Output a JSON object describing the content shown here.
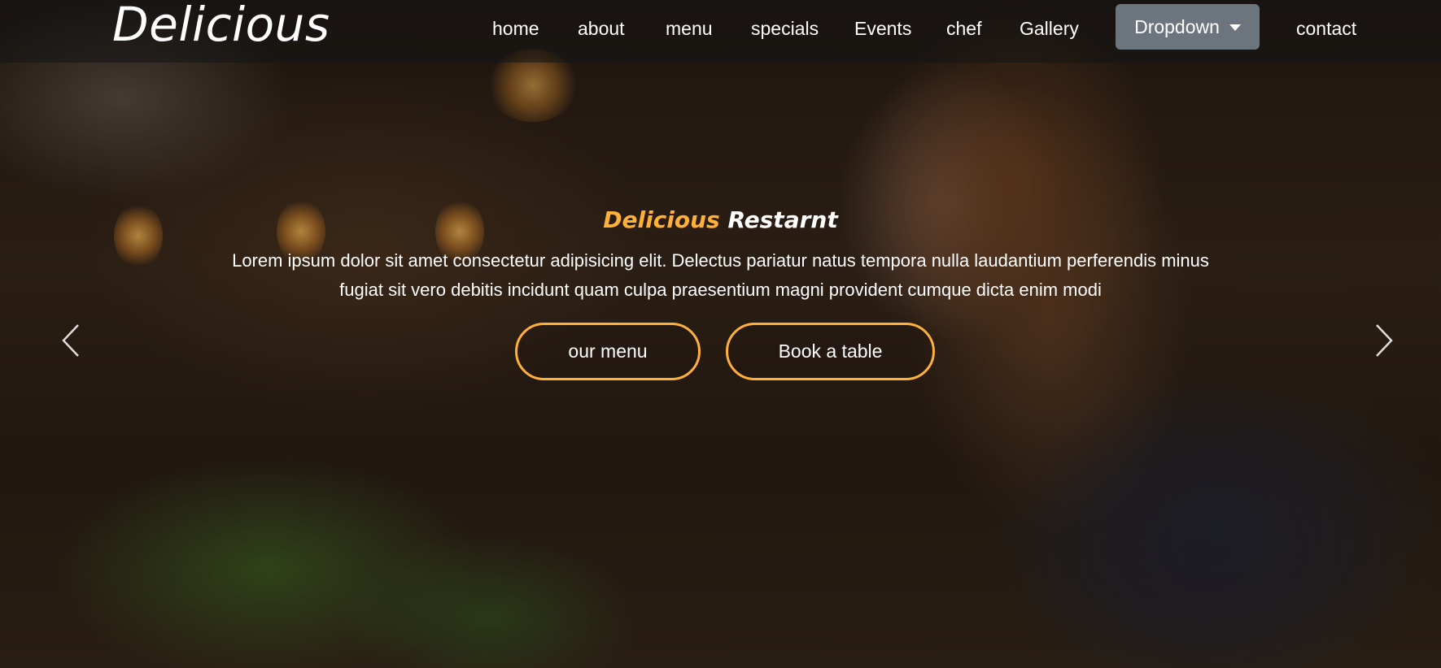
{
  "brand": {
    "name": "Delicious"
  },
  "nav": {
    "items": [
      "home",
      "about",
      "menu",
      "specials",
      "Events",
      "chef",
      "Gallery"
    ],
    "dropdown_label": "Dropdown",
    "contact_label": "contact"
  },
  "hero": {
    "title_highlight": "Delicious",
    "title_rest": "Restarnt",
    "text_line1": "Lorem ipsum dolor sit amet consectetur adipisicing elit. Delectus pariatur natus tempora nulla laudantium perferendis minus",
    "text_line2": "fugiat sit vero debitis incidunt quam culpa praesentium magni provident cumque dicta enim modi",
    "btn_menu": "our menu",
    "btn_book": "Book a table"
  },
  "icons": {
    "prev": "chevron-left-icon",
    "next": "chevron-right-icon",
    "dropdown": "caret-down-icon"
  },
  "colors": {
    "accent": "#ffb03b",
    "dropdown_bg": "#6c757d",
    "text": "#ffffff"
  }
}
